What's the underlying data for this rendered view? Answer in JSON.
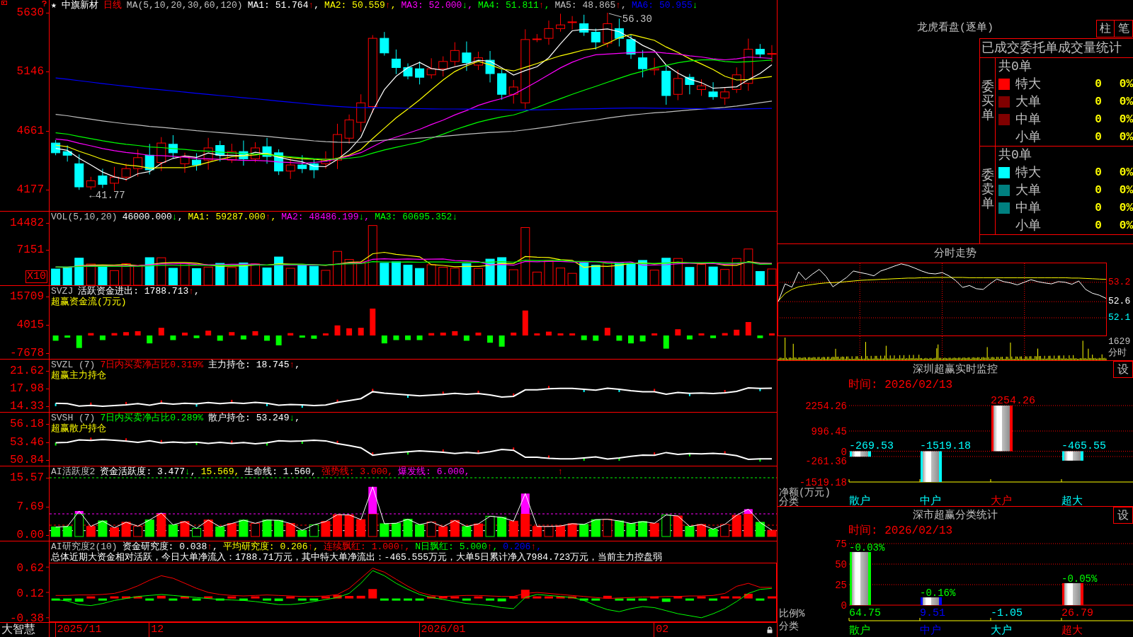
{
  "kline": {
    "star": "★",
    "stock": "中旗新材",
    "period": "日线",
    "params": "MA(5,10,20,30,60,120)",
    "readings": [
      {
        "text": "MA1: 51.764",
        "arrow": "↑",
        "rising": true,
        "suffix": ",",
        "color": "#ffffff"
      },
      {
        "text": "MA2: 50.559",
        "arrow": "↑",
        "rising": true,
        "suffix": ",",
        "color": "#ffff00"
      },
      {
        "text": "MA3: 52.000",
        "arrow": "↓",
        "rising": false,
        "suffix": ",",
        "color": "#ff00ff"
      },
      {
        "text": "MA4: 51.811",
        "arrow": "↑",
        "rising": true,
        "suffix": ",",
        "color": "#00ff00"
      },
      {
        "text": "MA5: 48.865",
        "arrow": "↑",
        "rising": true,
        "suffix": ",",
        "color": "#c0c0c0"
      },
      {
        "text": "MA6: 50.955",
        "arrow": "↓",
        "rising": false,
        "color": "#0000ff"
      }
    ],
    "y_labels": [
      "5630",
      "5146",
      "4661",
      "4177"
    ],
    "high_note": "56.30",
    "low_note": "←41.77"
  },
  "volume": {
    "title": "VOL(5,10,20)",
    "readings": [
      {
        "text": "46000.000",
        "arrow": "↓",
        "rising": false,
        "suffix": ",",
        "color": "#ffffff"
      },
      {
        "text": "MA1: 59287.000",
        "arrow": "↑",
        "rising": true,
        "suffix": ",",
        "color": "#ffff00"
      },
      {
        "text": "MA2: 48486.199",
        "arrow": "↓",
        "rising": false,
        "suffix": ",",
        "color": "#ff00ff"
      },
      {
        "text": "MA3: 60695.352",
        "arrow": "↓",
        "rising": false,
        "color": "#00ff00"
      }
    ],
    "y_labels": [
      "14482",
      "7151"
    ],
    "unit": "X10"
  },
  "fund_flow": {
    "title": "SVZJ",
    "readings": [
      {
        "text": "活跃资金进出: 1788.713",
        "arrow": "↑",
        "rising": true,
        "suffix": ",",
        "color": "#ffffff"
      }
    ],
    "subtitle": "超赢资金流(万元)",
    "y_labels": [
      "15709",
      "4015",
      "-7678"
    ]
  },
  "main_holding": {
    "title": "SVZL (7)",
    "note": {
      "text": "7日内买卖净占比0.319%",
      "color": "#ff0000"
    },
    "readings": [
      {
        "text": "主力持仓: 18.745",
        "arrow": "↑",
        "rising": true,
        "suffix": ",",
        "color": "#ffffff"
      }
    ],
    "subtitle": "超赢主力持仓",
    "y_labels": [
      "21.62",
      "17.98",
      "14.33"
    ]
  },
  "retail_holding": {
    "title": "SVSH (7)",
    "note": {
      "text": "7日内买卖净占比0.289%",
      "color": "#00ff00"
    },
    "readings": [
      {
        "text": "散户持仓: 53.249",
        "arrow": "↓",
        "rising": false,
        "suffix": ",",
        "color": "#ffffff"
      }
    ],
    "subtitle": "超赢散户持仓",
    "y_labels": [
      "56.18",
      "53.46",
      "50.84"
    ]
  },
  "activity": {
    "title": "AI活跃度2",
    "readings": [
      {
        "text": "资金活跃度: 3.477",
        "arrow": "↓",
        "rising": false,
        "suffix": ",",
        "color": "#ffffff"
      },
      {
        "text": "15.569",
        "suffix": ",",
        "color": "#ffff00"
      },
      {
        "text": "生命线: 1.560",
        "suffix": ",",
        "color": "#ffffff"
      },
      {
        "text": "强势线: 3.000",
        "suffix": ",",
        "color": "#ff0000"
      },
      {
        "text": "爆发线: 6.000",
        "suffix": ",",
        "color": "#ff00ff"
      }
    ],
    "signal": "↑",
    "y_labels": [
      "15.57",
      "7.69",
      "0.00"
    ]
  },
  "research": {
    "title": "AI研究度2(10)",
    "readings": [
      {
        "text": "资金研究度: 0.038",
        "arrow": "↑",
        "rising": true,
        "suffix": ",",
        "color": "#ffffff"
      },
      {
        "text": "平均研究度: 0.206",
        "arrow": "↑",
        "rising": true,
        "suffix": ",",
        "color": "#ffff00"
      },
      {
        "text": "连续飘红: 1.000",
        "arrow": "↑",
        "rising": true,
        "suffix": ",",
        "color": "#ff0000"
      },
      {
        "text": "N日飘红: 5.000",
        "arrow": "↑",
        "rising": true,
        "suffix": ",",
        "color": "#00ff00"
      },
      {
        "text": "0.206",
        "arrow": "↑",
        "rising": true,
        "suffix": ",",
        "color": "#0000ff"
      }
    ],
    "summary": "总体近期大资金相对活跃，今日大单净流入：1788.71万元，其中特大单净流出：-465.555万元，大单5日累计净入7984.723万元，当前主力控盘弱",
    "chart_data": {
      "type": "line",
      "ylim": [
        -0.46,
        0.7
      ],
      "yticks": [
        0.62,
        0.12,
        -0.38
      ],
      "series": [
        {
          "color": "#ff0000",
          "values": [
            0.06,
            0.06,
            0.07,
            0.07,
            0.08,
            0.1,
            0.16,
            0.25,
            0.36,
            0.45,
            0.4,
            0.3,
            0.2,
            0.12,
            0.08,
            0.06,
            0.05,
            0.06,
            0.07,
            0.06,
            0.05,
            0.04,
            0.04,
            0.05,
            0.08,
            0.2,
            0.4,
            0.6,
            0.52,
            0.38,
            0.24,
            0.12,
            0.06,
            0.04,
            0.05,
            0.06,
            0.06,
            0.05,
            0.04,
            0.04,
            0.1,
            0.12,
            0.1,
            0.08,
            0.06,
            0.04,
            0.02,
            0.0,
            0.01,
            0.02,
            0.03,
            0.03,
            0.04,
            0.04,
            0.05,
            0.05,
            0.06,
            0.1,
            0.24,
            0.3,
            0.22,
            0.22
          ]
        },
        {
          "color": "#00ff00",
          "values": [
            -0.02,
            -0.05,
            -0.12,
            -0.14,
            -0.1,
            -0.04,
            0.0,
            0.04,
            0.06,
            0.08,
            0.06,
            0.04,
            0.02,
            0.0,
            -0.02,
            -0.03,
            -0.04,
            -0.06,
            -0.09,
            -0.12,
            -0.12,
            -0.1,
            -0.06,
            -0.02,
            0.02,
            0.1,
            0.3,
            0.55,
            0.45,
            0.3,
            0.18,
            0.08,
            0.02,
            -0.02,
            -0.06,
            -0.1,
            -0.12,
            -0.14,
            -0.18,
            -0.2,
            0.02,
            0.08,
            0.06,
            0.04,
            0.02,
            -0.04,
            -0.14,
            -0.22,
            -0.26,
            -0.2,
            -0.16,
            -0.18,
            -0.24,
            -0.3,
            -0.34,
            -0.38,
            -0.3,
            -0.2,
            -0.06,
            0.1,
            0.18,
            0.2
          ]
        }
      ]
    }
  },
  "time_axis": {
    "brand": "大智慧",
    "dates": [
      "2025/11",
      "12",
      "2026/01",
      "02"
    ]
  },
  "order_book": {
    "title": "龙虎看盘(逐单)",
    "buttons": [
      "柱",
      "笔"
    ]
  },
  "order_stats": {
    "title": "已成交委托单成交量统计",
    "groups": [
      {
        "label": "委买单",
        "total": "共0单",
        "rows": [
          {
            "label": "特大",
            "count": "0",
            "share": "0%",
            "color": "#ff0000"
          },
          {
            "label": "大单",
            "count": "0",
            "share": "0%",
            "color": "#800000"
          },
          {
            "label": "中单",
            "count": "0",
            "share": "0%",
            "color": "#800000"
          },
          {
            "label": "小单",
            "count": "0",
            "share": "0%"
          }
        ]
      },
      {
        "label": "委卖单",
        "total": "共0单",
        "rows": [
          {
            "label": "特大",
            "count": "0",
            "share": "0%",
            "color": "#00ffff"
          },
          {
            "label": "大单",
            "count": "0",
            "share": "0%",
            "color": "#008080"
          },
          {
            "label": "中单",
            "count": "0",
            "share": "0%",
            "color": "#008080"
          },
          {
            "label": "小单",
            "count": "0",
            "share": "0%"
          }
        ]
      }
    ]
  },
  "intraday": {
    "title": "分时走势",
    "chart_data": {
      "type": "line",
      "ylim": [
        51.53,
        53.81
      ],
      "yticks": [
        53.2,
        52.6,
        52.1
      ],
      "grid": true,
      "series": [
        {
          "color": "#ffff00",
          "values": [
            52.62,
            52.85,
            52.98,
            53.06,
            53.1,
            53.13,
            53.16,
            53.18,
            53.19,
            53.2,
            53.22,
            53.24,
            53.26,
            53.27,
            53.28,
            53.29,
            53.3,
            53.31,
            53.32,
            53.33,
            53.33,
            53.34,
            53.34,
            53.35,
            53.35,
            53.35,
            53.35,
            53.35,
            53.34,
            53.34,
            53.34,
            53.34,
            53.34,
            53.34,
            53.34,
            53.34,
            53.34,
            53.34,
            53.34,
            53.34,
            53.34,
            53.34,
            53.34,
            53.33,
            53.33,
            53.32,
            53.31,
            53.3,
            53.29
          ]
        },
        {
          "color": "#ffffff",
          "values": [
            52.6,
            53.15,
            53.05,
            53.52,
            53.28,
            53.45,
            53.6,
            53.38,
            53.06,
            53.2,
            53.35,
            53.55,
            53.5,
            53.46,
            53.4,
            53.55,
            53.62,
            53.7,
            53.77,
            53.72,
            53.64,
            53.55,
            53.48,
            53.46,
            53.5,
            53.4,
            53.25,
            53.04,
            53.1,
            53.0,
            52.98,
            53.15,
            53.3,
            53.22,
            53.18,
            53.12,
            53.2,
            53.28,
            53.22,
            53.18,
            53.15,
            53.22,
            53.2,
            53.14,
            53.24,
            52.98,
            52.86,
            52.8,
            52.7
          ]
        }
      ]
    },
    "volume_label": "1629",
    "unit": "分时"
  },
  "sz_monitor": {
    "title": "深圳超赢实时监控",
    "settings": "设",
    "time": "时间: 2026/02/13",
    "y_caption": "净额(万元)",
    "x_caption": "分类",
    "chart_data": {
      "type": "bar",
      "categories": [
        "散户",
        "中户",
        "大户",
        "超大"
      ],
      "values": [
        -269.53,
        -1519.18,
        2254.26,
        -465.55
      ],
      "ylim": [
        -1519.18,
        2254.26
      ],
      "yticks": [
        2254.26,
        996.45,
        0,
        -261.36,
        -1519.18
      ],
      "grid": true
    },
    "items": [
      {
        "label": "-269.53",
        "color": "#00ffff"
      },
      {
        "label": "-1519.18",
        "color": "#00ffff"
      },
      {
        "label": "2254.26",
        "color": "#ff0000"
      },
      {
        "label": "-465.55",
        "color": "#00ffff"
      }
    ]
  },
  "sz_stats": {
    "title": "深市超赢分类统计",
    "settings": "设",
    "time": "时间: 2026/02/13",
    "y_caption": "比例%",
    "x_caption": "分类",
    "chart_data": {
      "type": "bar",
      "categories": [
        "散户",
        "中户",
        "大户",
        "超大"
      ],
      "values": [
        64.75,
        9.51,
        null,
        26.79
      ],
      "ylim": [
        0,
        75
      ],
      "yticks": [
        75,
        50,
        25,
        0
      ],
      "grid": true
    },
    "items": [
      {
        "value": "64.75",
        "change": "-0.03%",
        "color": "#00ff00"
      },
      {
        "value": "9.51",
        "change": "-0.16%",
        "color": "#0000ff"
      },
      {
        "value": "-1.05",
        "color": "#00ffff"
      },
      {
        "value": "26.79",
        "change": "-0.05%",
        "color": "#ff0000"
      }
    ]
  }
}
